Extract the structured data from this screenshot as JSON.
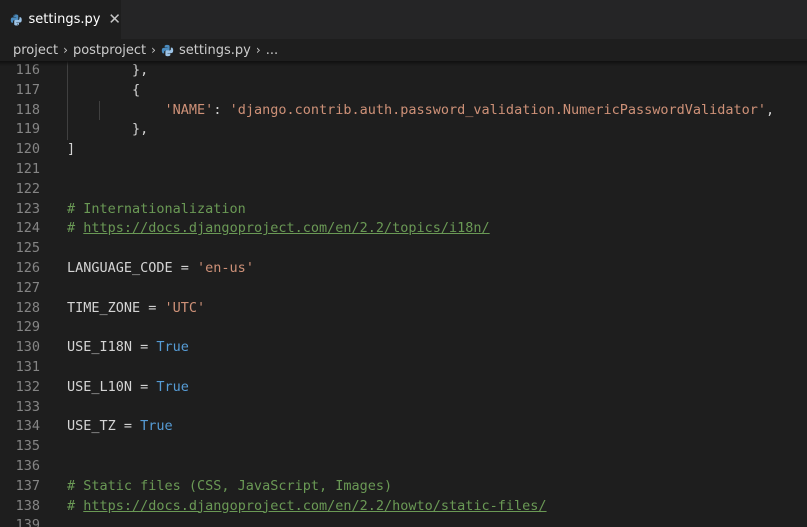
{
  "tab": {
    "label": "settings.py",
    "close_glyph": "✕",
    "icon": "python-icon"
  },
  "breadcrumb": {
    "items": [
      "project",
      "postproject",
      "settings.py",
      "..."
    ],
    "separator": "›"
  },
  "colors": {
    "background": "#1e1e1e",
    "string": "#ce9178",
    "comment": "#6a9955",
    "keyword": "#569cd6",
    "line_number": "#858585"
  },
  "editor": {
    "lines": [
      {
        "n": "116",
        "tokens": [
          {
            "c": "t-txt",
            "t": "        },"
          }
        ]
      },
      {
        "n": "117",
        "tokens": [
          {
            "c": "t-txt",
            "t": "        {"
          }
        ]
      },
      {
        "n": "118",
        "tokens": [
          {
            "c": "t-txt",
            "t": "            "
          },
          {
            "c": "t-str",
            "t": "'NAME'"
          },
          {
            "c": "t-txt",
            "t": ": "
          },
          {
            "c": "t-str",
            "t": "'django.contrib.auth.password_validation.NumericPasswordValidator'"
          },
          {
            "c": "t-txt",
            "t": ","
          }
        ]
      },
      {
        "n": "119",
        "tokens": [
          {
            "c": "t-txt",
            "t": "        },"
          }
        ]
      },
      {
        "n": "120",
        "tokens": [
          {
            "c": "t-txt",
            "t": "]"
          }
        ]
      },
      {
        "n": "121",
        "tokens": []
      },
      {
        "n": "122",
        "tokens": []
      },
      {
        "n": "123",
        "tokens": [
          {
            "c": "t-com",
            "t": "# Internationalization"
          }
        ]
      },
      {
        "n": "124",
        "tokens": [
          {
            "c": "t-com",
            "t": "# "
          },
          {
            "c": "t-link",
            "t": "https://docs.djangoproject.com/en/2.2/topics/i18n/"
          }
        ]
      },
      {
        "n": "125",
        "tokens": []
      },
      {
        "n": "126",
        "tokens": [
          {
            "c": "t-txt",
            "t": "LANGUAGE_CODE = "
          },
          {
            "c": "t-str",
            "t": "'en-us'"
          }
        ]
      },
      {
        "n": "127",
        "tokens": []
      },
      {
        "n": "128",
        "tokens": [
          {
            "c": "t-txt",
            "t": "TIME_ZONE = "
          },
          {
            "c": "t-str",
            "t": "'UTC'"
          }
        ]
      },
      {
        "n": "129",
        "tokens": []
      },
      {
        "n": "130",
        "tokens": [
          {
            "c": "t-txt",
            "t": "USE_I18N = "
          },
          {
            "c": "t-kw",
            "t": "True"
          }
        ]
      },
      {
        "n": "131",
        "tokens": []
      },
      {
        "n": "132",
        "tokens": [
          {
            "c": "t-txt",
            "t": "USE_L10N = "
          },
          {
            "c": "t-kw",
            "t": "True"
          }
        ]
      },
      {
        "n": "133",
        "tokens": []
      },
      {
        "n": "134",
        "tokens": [
          {
            "c": "t-txt",
            "t": "USE_TZ = "
          },
          {
            "c": "t-kw",
            "t": "True"
          }
        ]
      },
      {
        "n": "135",
        "tokens": []
      },
      {
        "n": "136",
        "tokens": []
      },
      {
        "n": "137",
        "tokens": [
          {
            "c": "t-com",
            "t": "# Static files (CSS, JavaScript, Images)"
          }
        ]
      },
      {
        "n": "138",
        "tokens": [
          {
            "c": "t-com",
            "t": "# "
          },
          {
            "c": "t-link",
            "t": "https://docs.djangoproject.com/en/2.2/howto/static-files/"
          }
        ]
      },
      {
        "n": "139",
        "tokens": []
      }
    ]
  }
}
